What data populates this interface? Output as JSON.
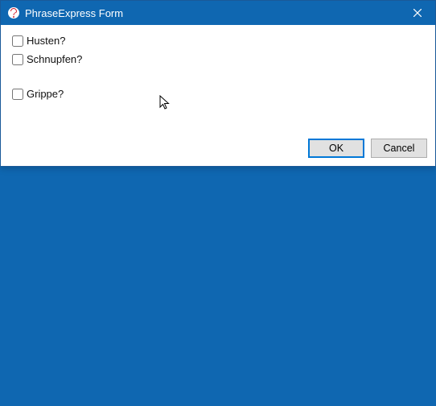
{
  "window": {
    "title": "PhraseExpress Form"
  },
  "checkboxes": [
    {
      "label": "Husten?",
      "checked": false
    },
    {
      "label": "Schnupfen?",
      "checked": false
    },
    {
      "label": "Grippe?",
      "checked": false
    }
  ],
  "buttons": {
    "ok": "OK",
    "cancel": "Cancel"
  }
}
